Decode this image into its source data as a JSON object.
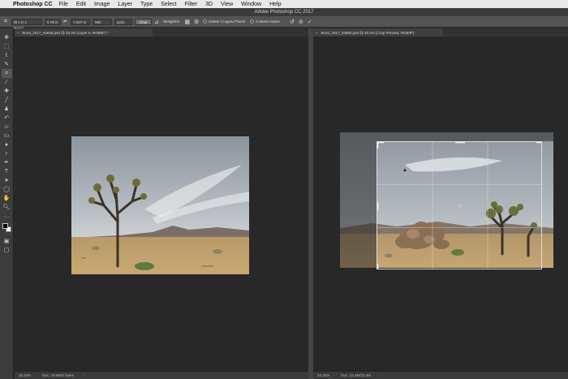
{
  "menubar": {
    "app_name": "Photoshop CC",
    "items": [
      "File",
      "Edit",
      "Image",
      "Layer",
      "Type",
      "Select",
      "Filter",
      "3D",
      "View",
      "Window",
      "Help"
    ]
  },
  "window_title": "Adobe Photoshop CC 2017",
  "options": {
    "ratio_preset": "W x H x Resol...",
    "width_value": "0.79 in",
    "height_value": "7.607 in",
    "resolution_value": "800",
    "resolution_unit": "px/in",
    "clear_label": "Clear",
    "straighten_label": "Straighten",
    "delete_cropped_label": "Delete Cropped Pixels",
    "content_aware_label": "Content-Aware"
  },
  "documents": [
    {
      "tab_title": "JKost_2017_04645.psd @ 33.3% (Layer 0, RGB/8*) *",
      "zoom": "33.33%",
      "doc_size": "Doc: 19.8M/0 bytes"
    },
    {
      "tab_title": "JKost_2017_04593.psd @ 33.3% (Crop Preview, RGB/8*)",
      "zoom": "33.33%",
      "doc_size": "Doc: 23.4M/23.4M"
    }
  ],
  "colors": {
    "canvas_bg": "#282828",
    "toolbar_bg": "#3c3c3c",
    "options_bg": "#535353",
    "menubar_bg": "#e9e9e9"
  },
  "tools": [
    "move-tool",
    "marquee-tool",
    "lasso-tool",
    "quick-select-tool",
    "crop-tool",
    "eyedropper-tool",
    "healing-brush-tool",
    "brush-tool",
    "clone-stamp-tool",
    "history-brush-tool",
    "eraser-tool",
    "gradient-tool",
    "blur-tool",
    "dodge-tool",
    "pen-tool",
    "type-tool",
    "path-select-tool",
    "shape-tool",
    "hand-tool",
    "zoom-tool"
  ]
}
